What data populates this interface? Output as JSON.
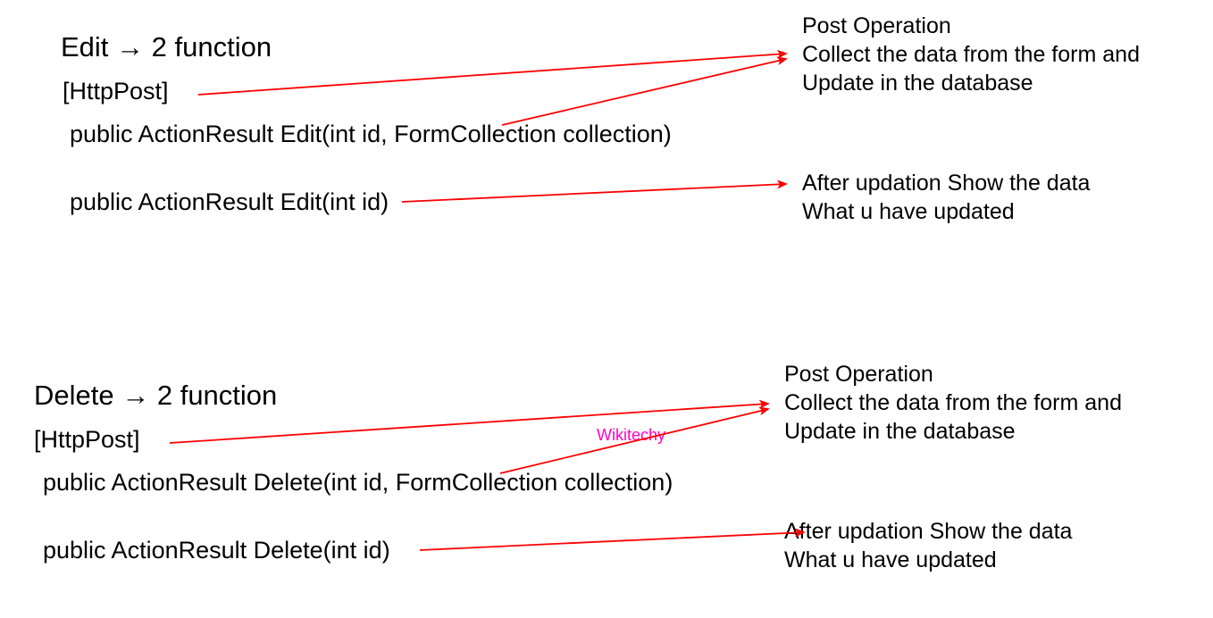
{
  "edit": {
    "title_prefix": "Edit ",
    "title_suffix": " 2 function",
    "attr": "[HttpPost]",
    "sig_post": "public ActionResult Edit(int id, FormCollection collection)",
    "sig_get": "public ActionResult Edit(int id)",
    "note_post_l1": "Post Operation",
    "note_post_l2": "Collect the data from the form and",
    "note_post_l3": "Update in the database",
    "note_get_l1": "After updation Show the data",
    "note_get_l2": "What u have updated"
  },
  "delete": {
    "title_prefix": "Delete ",
    "title_suffix": " 2 function",
    "attr": "[HttpPost]",
    "sig_post": "public ActionResult Delete(int id, FormCollection collection)",
    "sig_get": "public ActionResult Delete(int id)",
    "note_post_l1": "Post Operation",
    "note_post_l2": "Collect the data from the form and",
    "note_post_l3": "Update in the database",
    "note_get_l1": "After updation Show the data",
    "note_get_l2": "What u have updated"
  },
  "watermark": "Wikitechy",
  "arrow_glyph": "→"
}
